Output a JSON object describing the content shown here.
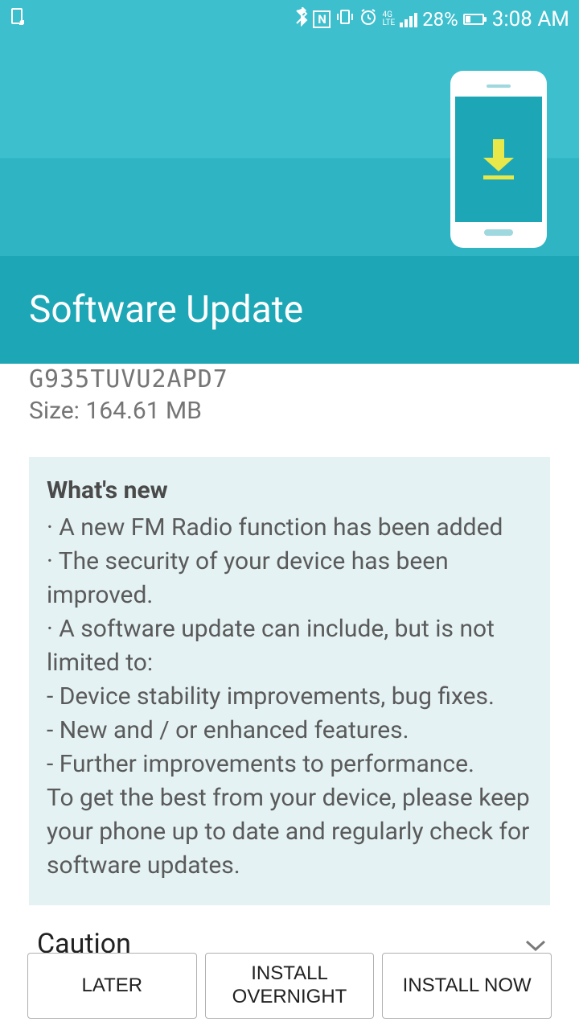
{
  "statusBar": {
    "batteryPercent": "28%",
    "time": "3:08 AM"
  },
  "header": {
    "title": "Software Update"
  },
  "update": {
    "version": "G935TUVU2APD7",
    "sizeLabel": "Size: 164.61 MB"
  },
  "whatsNew": {
    "title": "What's new",
    "body": "· A new FM Radio function has been added\n· The security of your device has been improved.\n· A software update can include, but is not limited to:\n - Device stability improvements, bug fixes.\n - New and / or enhanced features.\n - Further improvements to performance.\nTo get the best from your device, please keep your phone up to date and regularly check for software updates."
  },
  "caution": {
    "label": "Caution"
  },
  "buttons": {
    "later": "LATER",
    "installOvernight": "INSTALL\nOVERNIGHT",
    "installNow": "INSTALL NOW"
  }
}
